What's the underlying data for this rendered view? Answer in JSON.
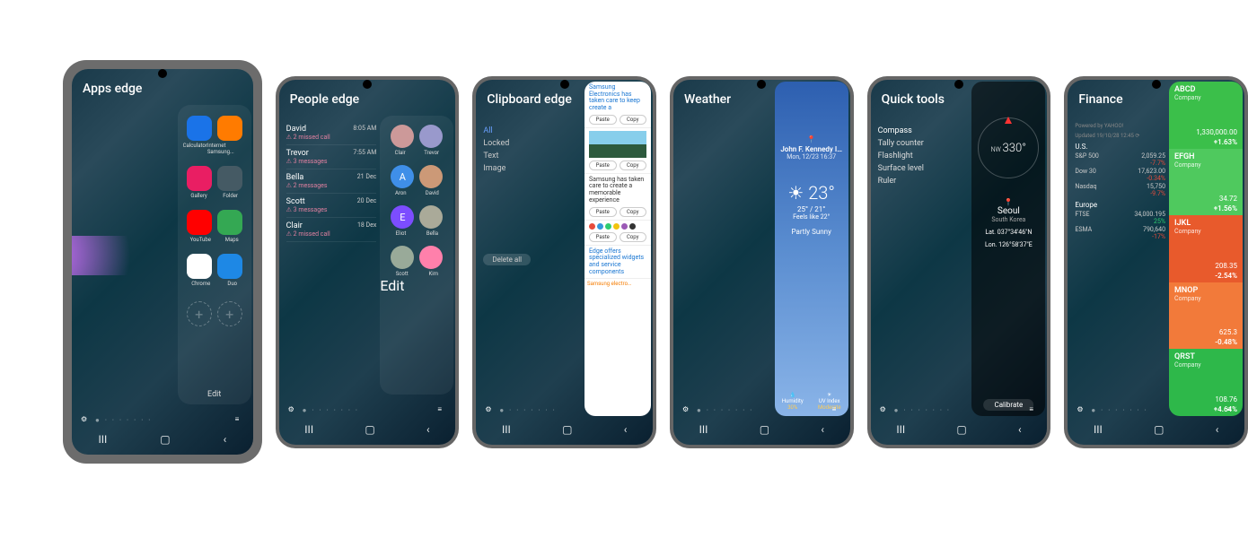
{
  "screens": [
    {
      "title": "Apps edge",
      "edit": "Edit",
      "apps": [
        {
          "name": "Calculator",
          "bg": "#1a73e8"
        },
        {
          "name": "Internet Samsung...",
          "bg": "#ff7b00"
        },
        {
          "name": "Gallery",
          "bg": "#e91e63"
        },
        {
          "name": "Folder",
          "bg": "#455a64"
        },
        {
          "name": "YouTube",
          "bg": "#ff0000"
        },
        {
          "name": "Maps",
          "bg": "#34a853"
        },
        {
          "name": "Chrome",
          "bg": "#ffffff"
        },
        {
          "name": "Duo",
          "bg": "#1e88e5"
        }
      ]
    },
    {
      "title": "People edge",
      "edit": "Edit",
      "people_recent": [
        {
          "name": "David",
          "sub": "2 missed call",
          "time": "8:05 AM"
        },
        {
          "name": "Trevor",
          "sub": "3 messages",
          "time": "7:55 AM"
        },
        {
          "name": "Bella",
          "sub": "2 messages",
          "time": "21 Dec"
        },
        {
          "name": "Scott",
          "sub": "3 messages",
          "time": "20 Dec"
        },
        {
          "name": "Clair",
          "sub": "2 missed call",
          "time": "18 Dex"
        }
      ],
      "contacts": [
        {
          "name": "Clair",
          "bg": "#c99"
        },
        {
          "name": "Trevor",
          "bg": "#99c"
        },
        {
          "name": "Aron",
          "bg": "#3f8fe8",
          "letter": "A"
        },
        {
          "name": "David",
          "bg": "#c97"
        },
        {
          "name": "Eliot",
          "bg": "#7c4dff",
          "letter": "E"
        },
        {
          "name": "Bella",
          "bg": "#aa9"
        },
        {
          "name": "Scott",
          "bg": "#9a9"
        },
        {
          "name": "Kim",
          "bg": "#ff80ab"
        }
      ]
    },
    {
      "title": "Clipboard edge",
      "filters": {
        "all": "All",
        "locked": "Locked",
        "text": "Text",
        "image": "Image"
      },
      "delete_all": "Delete all",
      "clips": [
        {
          "type": "text",
          "text": "Samsung Electronics has taken care to keep create a",
          "paste": "Paste",
          "copy": "Copy"
        },
        {
          "type": "image",
          "paste": "Paste",
          "copy": "Copy"
        },
        {
          "type": "text2",
          "text": "Samsung has taken care to create a memorable experience",
          "paste": "Paste",
          "copy": "Copy"
        },
        {
          "type": "dots",
          "paste": "Paste",
          "copy": "Copy"
        },
        {
          "type": "text",
          "text": "Edge offers specialized widgets and service components"
        },
        {
          "type": "badge",
          "text": "Samsung electro…"
        }
      ]
    },
    {
      "title": "Weather",
      "weather": {
        "loc": "John F. Kennedy I…",
        "date": "Mon, 12/23 16:37",
        "temp": "23°",
        "hl": "25° / 21°",
        "feels": "Feels like 22°",
        "cond": "Partly Sunny",
        "humidity_label": "Humidity",
        "humidity": "30%",
        "uv_label": "UV Index",
        "uv": "Moderate"
      }
    },
    {
      "title": "Quick tools",
      "tools": [
        "Compass",
        "Tally counter",
        "Flashlight",
        "Surface level",
        "Ruler"
      ],
      "compass": {
        "dir": "NW",
        "deg": "330°",
        "city": "Seoul",
        "country": "South Korea",
        "lat": "Lat. 037°34'46\"N",
        "lon": "Lon. 126°58'37\"E",
        "calibrate": "Calibrate"
      }
    },
    {
      "title": "Finance",
      "chevron": "›",
      "powered": "Powered by YAHOO!",
      "updated": "Updated 19/10/28 12:45 ⟳",
      "sections": [
        {
          "name": "U.S.",
          "rows": [
            {
              "n": "S&P 500",
              "v": "2,059.25",
              "c": "-7.7%",
              "dir": "dn"
            },
            {
              "n": "Dow 30",
              "v": "17,623.00",
              "c": "-0.34%",
              "dir": "dn"
            },
            {
              "n": "Nasdaq",
              "v": "15,750",
              "c": "-9.7%",
              "dir": "dn"
            }
          ]
        },
        {
          "name": "Europe",
          "rows": [
            {
              "n": "FTSE",
              "v": "34,000.195",
              "c": "25%",
              "dir": "up"
            },
            {
              "n": "ESMA",
              "v": "790,640",
              "c": "-17%",
              "dir": "dn"
            }
          ]
        }
      ],
      "stocks": [
        {
          "sym": "ABCD",
          "co": "Company",
          "price": "1,330,000.00",
          "pct": "+1.63%",
          "bg": "#3bbf4a"
        },
        {
          "sym": "EFGH",
          "co": "Company",
          "price": "34.72",
          "pct": "+1.56%",
          "bg": "#4fc95e"
        },
        {
          "sym": "IJKL",
          "co": "Company",
          "price": "208.35",
          "pct": "-2.54%",
          "bg": "#e85a2c"
        },
        {
          "sym": "MNOP",
          "co": "Company",
          "price": "625.3",
          "pct": "-0.48%",
          "bg": "#f27a3a"
        },
        {
          "sym": "QRST",
          "co": "Company",
          "price": "108.76",
          "pct": "+4.64%",
          "bg": "#2eb84a"
        }
      ]
    }
  ],
  "nav": {
    "recent": "III",
    "home": "▢",
    "back": "‹"
  }
}
